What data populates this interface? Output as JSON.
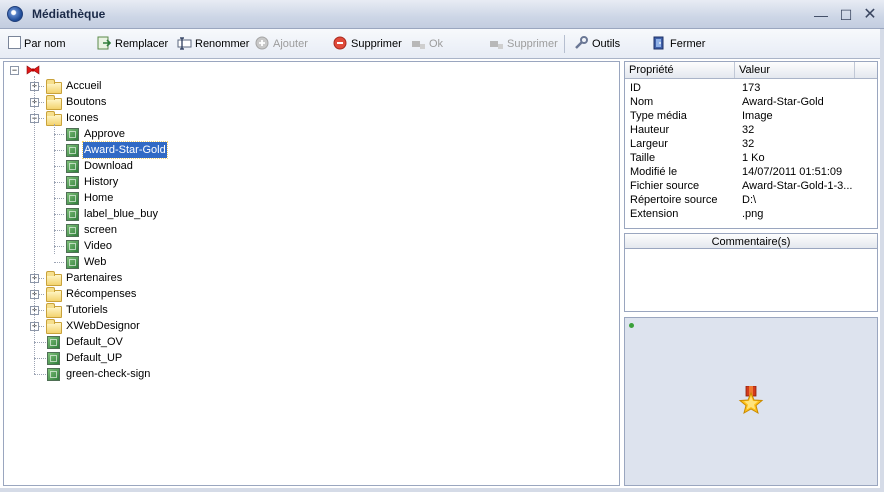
{
  "window": {
    "title": "Médiathèque",
    "controls": {
      "minimize": "—",
      "maximize": "☐",
      "close": "✕"
    }
  },
  "toolbar": {
    "par_nom": "Par nom",
    "remplacer": "Remplacer",
    "renommer": "Renommer",
    "ajouter": "Ajouter",
    "supprimer": "Supprimer",
    "ok": "Ok",
    "supprimer2": "Supprimer",
    "outils": "Outils",
    "fermer": "Fermer"
  },
  "tree": {
    "items": [
      {
        "label": "Accueil",
        "type": "folder",
        "expanded": false
      },
      {
        "label": "Boutons",
        "type": "folder",
        "expanded": false
      },
      {
        "label": "Icones",
        "type": "folder",
        "expanded": true
      },
      {
        "label": "Approve",
        "type": "image"
      },
      {
        "label": "Award-Star-Gold",
        "type": "image",
        "selected": true
      },
      {
        "label": "Download",
        "type": "image"
      },
      {
        "label": "History",
        "type": "image"
      },
      {
        "label": "Home",
        "type": "image"
      },
      {
        "label": "label_blue_buy",
        "type": "image"
      },
      {
        "label": "screen",
        "type": "image"
      },
      {
        "label": "Video",
        "type": "image"
      },
      {
        "label": "Web",
        "type": "image"
      },
      {
        "label": "Partenaires",
        "type": "folder",
        "expanded": false
      },
      {
        "label": "Récompenses",
        "type": "folder",
        "expanded": false
      },
      {
        "label": "Tutoriels",
        "type": "folder",
        "expanded": false
      },
      {
        "label": "XWebDesignor",
        "type": "folder",
        "expanded": false
      },
      {
        "label": "Default_OV",
        "type": "image"
      },
      {
        "label": "Default_UP",
        "type": "image"
      },
      {
        "label": "green-check-sign",
        "type": "image"
      }
    ]
  },
  "properties": {
    "headers": {
      "key": "Propriété",
      "value": "Valeur"
    },
    "rows": [
      {
        "key": "ID",
        "value": "173"
      },
      {
        "key": "Nom",
        "value": "Award-Star-Gold"
      },
      {
        "key": "Type média",
        "value": "Image"
      },
      {
        "key": "Hauteur",
        "value": "32"
      },
      {
        "key": "Largeur",
        "value": "32"
      },
      {
        "key": "Taille",
        "value": "1 Ko"
      },
      {
        "key": "Modifié le",
        "value": "14/07/2011 01:51:09"
      },
      {
        "key": "Fichier source",
        "value": "Award-Star-Gold-1-3..."
      },
      {
        "key": "Répertoire source",
        "value": "D:\\"
      },
      {
        "key": "Extension",
        "value": ".png"
      }
    ]
  },
  "comment": {
    "header": "Commentaire(s)"
  },
  "colors": {
    "selection": "#316ac5",
    "accent": "#cdd6e6",
    "status_ok": "#3aa03a"
  }
}
